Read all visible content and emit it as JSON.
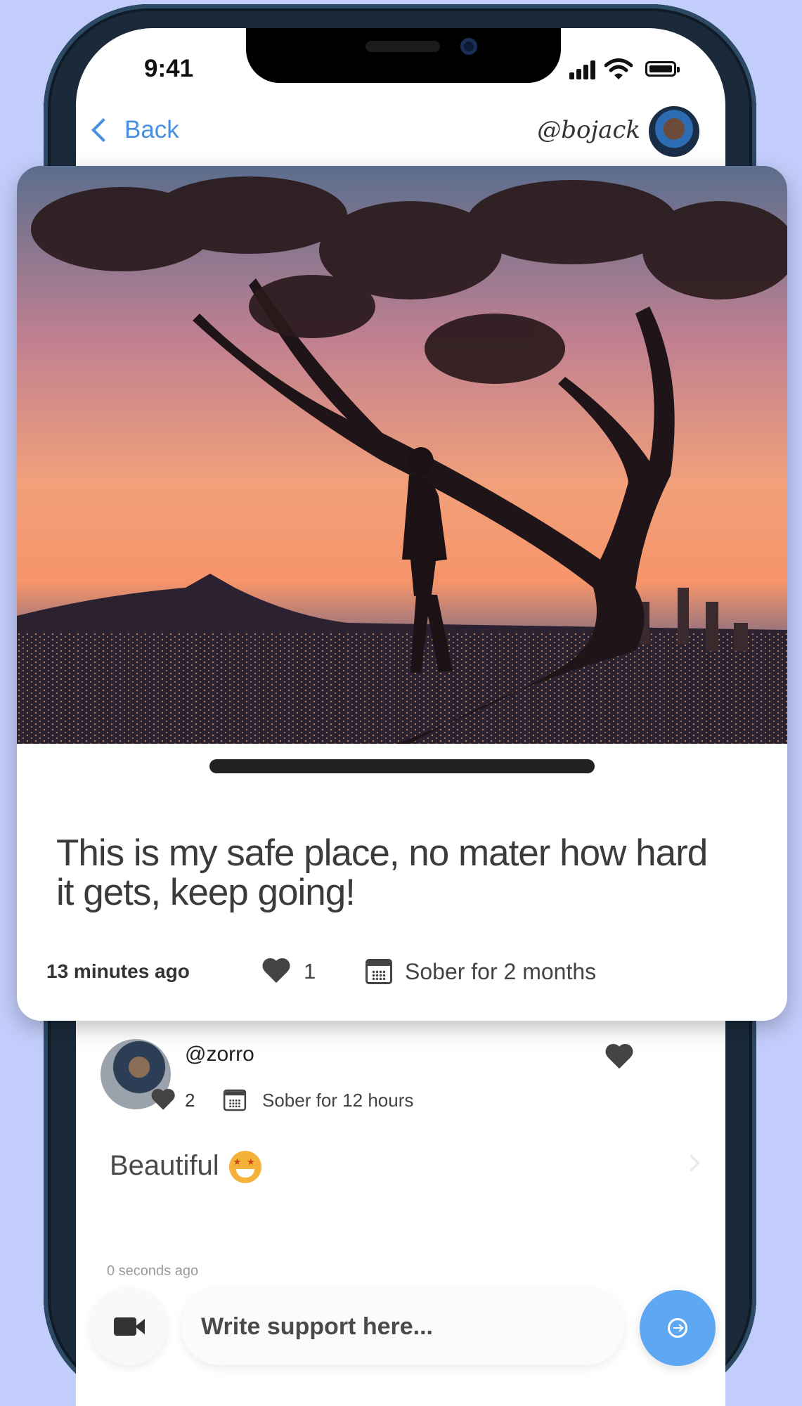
{
  "status_bar": {
    "time": "9:41"
  },
  "nav": {
    "back_label": "Back",
    "user_handle": "@bojack"
  },
  "post": {
    "text": "This is my safe place, no mater how hard it gets, keep going!",
    "time_ago": "13 minutes ago",
    "like_count": "1",
    "sober_status": "Sober for 2 months"
  },
  "comment": {
    "username": "@zorro",
    "like_count": "2",
    "sober_status": "Sober for 12 hours",
    "text": "Beautiful",
    "time_ago": "0 seconds ago"
  },
  "composer": {
    "placeholder": "Write support here..."
  },
  "colors": {
    "background": "#c3cdfb",
    "accent": "#4a90e2",
    "send_button": "#5ea8f3"
  },
  "icons": [
    "back-chevron-icon",
    "signal-icon",
    "wifi-icon",
    "battery-icon",
    "heart-icon",
    "calendar-icon",
    "starstruck-emoji-icon",
    "chevron-right-icon",
    "video-camera-icon",
    "send-icon"
  ]
}
